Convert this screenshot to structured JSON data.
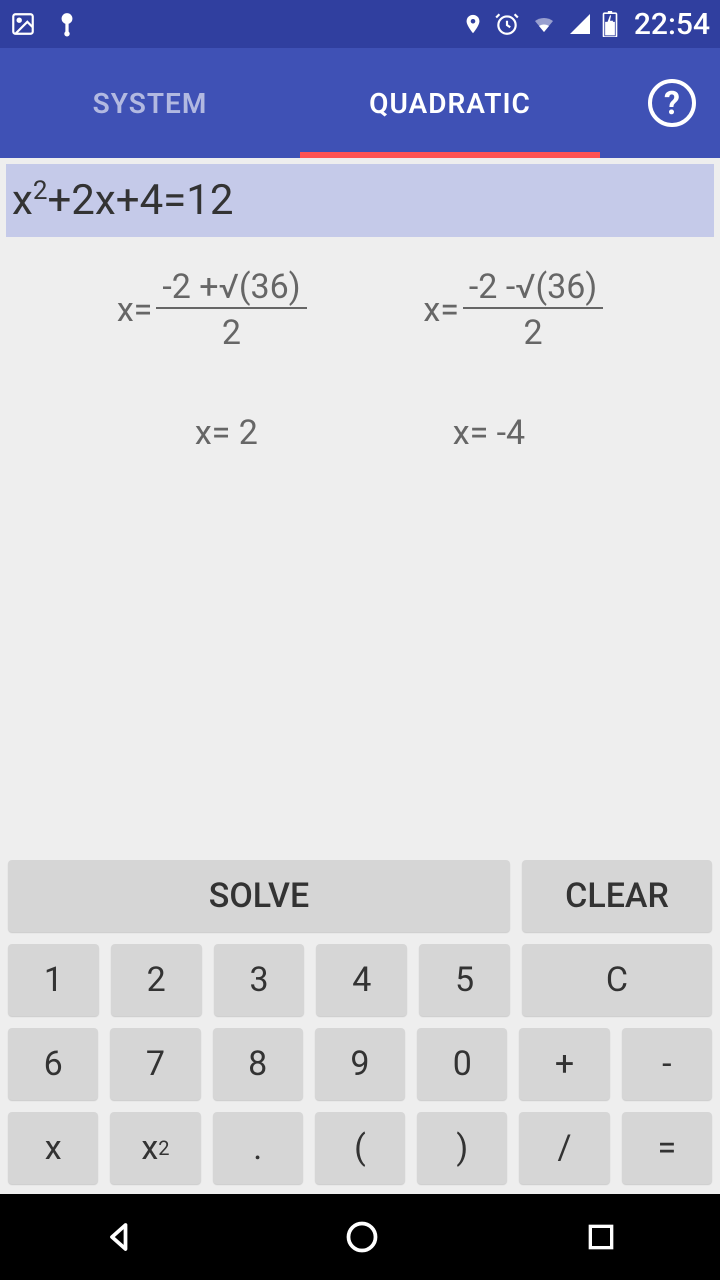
{
  "status": {
    "time": "22:54"
  },
  "tabs": {
    "system": "SYSTEM",
    "quadratic": "QUADRATIC"
  },
  "help": "?",
  "equation": {
    "base1": "x",
    "sup": "2",
    "rest": "+2x+4=12"
  },
  "formula1": {
    "prefix": "x=",
    "num": "-2 +√(36)",
    "den": "2"
  },
  "formula2": {
    "prefix": "x=",
    "num": "-2 -√(36)",
    "den": "2"
  },
  "root1": "x= 2",
  "root2": "x= -4",
  "buttons": {
    "solve": "SOLVE",
    "clear": "CLEAR",
    "k1": "1",
    "k2": "2",
    "k3": "3",
    "k4": "4",
    "k5": "5",
    "kc": "C",
    "k6": "6",
    "k7": "7",
    "k8": "8",
    "k9": "9",
    "k0": "0",
    "kplus": "+",
    "kminus": "-",
    "kx": "x",
    "kx2a": "x",
    "kx2b": "2",
    "kdot": ".",
    "klp": "(",
    "krp": ")",
    "kdiv": "/",
    "keq": "="
  }
}
